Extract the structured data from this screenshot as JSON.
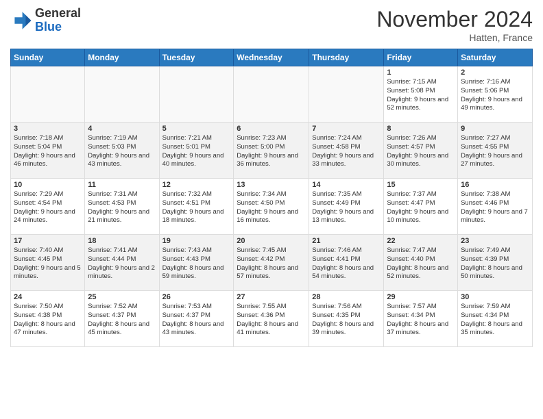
{
  "header": {
    "logo_line1": "General",
    "logo_line2": "Blue",
    "month": "November 2024",
    "location": "Hatten, France"
  },
  "weekdays": [
    "Sunday",
    "Monday",
    "Tuesday",
    "Wednesday",
    "Thursday",
    "Friday",
    "Saturday"
  ],
  "weeks": [
    [
      {
        "day": "",
        "info": ""
      },
      {
        "day": "",
        "info": ""
      },
      {
        "day": "",
        "info": ""
      },
      {
        "day": "",
        "info": ""
      },
      {
        "day": "",
        "info": ""
      },
      {
        "day": "1",
        "info": "Sunrise: 7:15 AM\nSunset: 5:08 PM\nDaylight: 9 hours\nand 52 minutes."
      },
      {
        "day": "2",
        "info": "Sunrise: 7:16 AM\nSunset: 5:06 PM\nDaylight: 9 hours\nand 49 minutes."
      }
    ],
    [
      {
        "day": "3",
        "info": "Sunrise: 7:18 AM\nSunset: 5:04 PM\nDaylight: 9 hours\nand 46 minutes."
      },
      {
        "day": "4",
        "info": "Sunrise: 7:19 AM\nSunset: 5:03 PM\nDaylight: 9 hours\nand 43 minutes."
      },
      {
        "day": "5",
        "info": "Sunrise: 7:21 AM\nSunset: 5:01 PM\nDaylight: 9 hours\nand 40 minutes."
      },
      {
        "day": "6",
        "info": "Sunrise: 7:23 AM\nSunset: 5:00 PM\nDaylight: 9 hours\nand 36 minutes."
      },
      {
        "day": "7",
        "info": "Sunrise: 7:24 AM\nSunset: 4:58 PM\nDaylight: 9 hours\nand 33 minutes."
      },
      {
        "day": "8",
        "info": "Sunrise: 7:26 AM\nSunset: 4:57 PM\nDaylight: 9 hours\nand 30 minutes."
      },
      {
        "day": "9",
        "info": "Sunrise: 7:27 AM\nSunset: 4:55 PM\nDaylight: 9 hours\nand 27 minutes."
      }
    ],
    [
      {
        "day": "10",
        "info": "Sunrise: 7:29 AM\nSunset: 4:54 PM\nDaylight: 9 hours\nand 24 minutes."
      },
      {
        "day": "11",
        "info": "Sunrise: 7:31 AM\nSunset: 4:53 PM\nDaylight: 9 hours\nand 21 minutes."
      },
      {
        "day": "12",
        "info": "Sunrise: 7:32 AM\nSunset: 4:51 PM\nDaylight: 9 hours\nand 18 minutes."
      },
      {
        "day": "13",
        "info": "Sunrise: 7:34 AM\nSunset: 4:50 PM\nDaylight: 9 hours\nand 16 minutes."
      },
      {
        "day": "14",
        "info": "Sunrise: 7:35 AM\nSunset: 4:49 PM\nDaylight: 9 hours\nand 13 minutes."
      },
      {
        "day": "15",
        "info": "Sunrise: 7:37 AM\nSunset: 4:47 PM\nDaylight: 9 hours\nand 10 minutes."
      },
      {
        "day": "16",
        "info": "Sunrise: 7:38 AM\nSunset: 4:46 PM\nDaylight: 9 hours\nand 7 minutes."
      }
    ],
    [
      {
        "day": "17",
        "info": "Sunrise: 7:40 AM\nSunset: 4:45 PM\nDaylight: 9 hours\nand 5 minutes."
      },
      {
        "day": "18",
        "info": "Sunrise: 7:41 AM\nSunset: 4:44 PM\nDaylight: 9 hours\nand 2 minutes."
      },
      {
        "day": "19",
        "info": "Sunrise: 7:43 AM\nSunset: 4:43 PM\nDaylight: 8 hours\nand 59 minutes."
      },
      {
        "day": "20",
        "info": "Sunrise: 7:45 AM\nSunset: 4:42 PM\nDaylight: 8 hours\nand 57 minutes."
      },
      {
        "day": "21",
        "info": "Sunrise: 7:46 AM\nSunset: 4:41 PM\nDaylight: 8 hours\nand 54 minutes."
      },
      {
        "day": "22",
        "info": "Sunrise: 7:47 AM\nSunset: 4:40 PM\nDaylight: 8 hours\nand 52 minutes."
      },
      {
        "day": "23",
        "info": "Sunrise: 7:49 AM\nSunset: 4:39 PM\nDaylight: 8 hours\nand 50 minutes."
      }
    ],
    [
      {
        "day": "24",
        "info": "Sunrise: 7:50 AM\nSunset: 4:38 PM\nDaylight: 8 hours\nand 47 minutes."
      },
      {
        "day": "25",
        "info": "Sunrise: 7:52 AM\nSunset: 4:37 PM\nDaylight: 8 hours\nand 45 minutes."
      },
      {
        "day": "26",
        "info": "Sunrise: 7:53 AM\nSunset: 4:37 PM\nDaylight: 8 hours\nand 43 minutes."
      },
      {
        "day": "27",
        "info": "Sunrise: 7:55 AM\nSunset: 4:36 PM\nDaylight: 8 hours\nand 41 minutes."
      },
      {
        "day": "28",
        "info": "Sunrise: 7:56 AM\nSunset: 4:35 PM\nDaylight: 8 hours\nand 39 minutes."
      },
      {
        "day": "29",
        "info": "Sunrise: 7:57 AM\nSunset: 4:34 PM\nDaylight: 8 hours\nand 37 minutes."
      },
      {
        "day": "30",
        "info": "Sunrise: 7:59 AM\nSunset: 4:34 PM\nDaylight: 8 hours\nand 35 minutes."
      }
    ]
  ]
}
